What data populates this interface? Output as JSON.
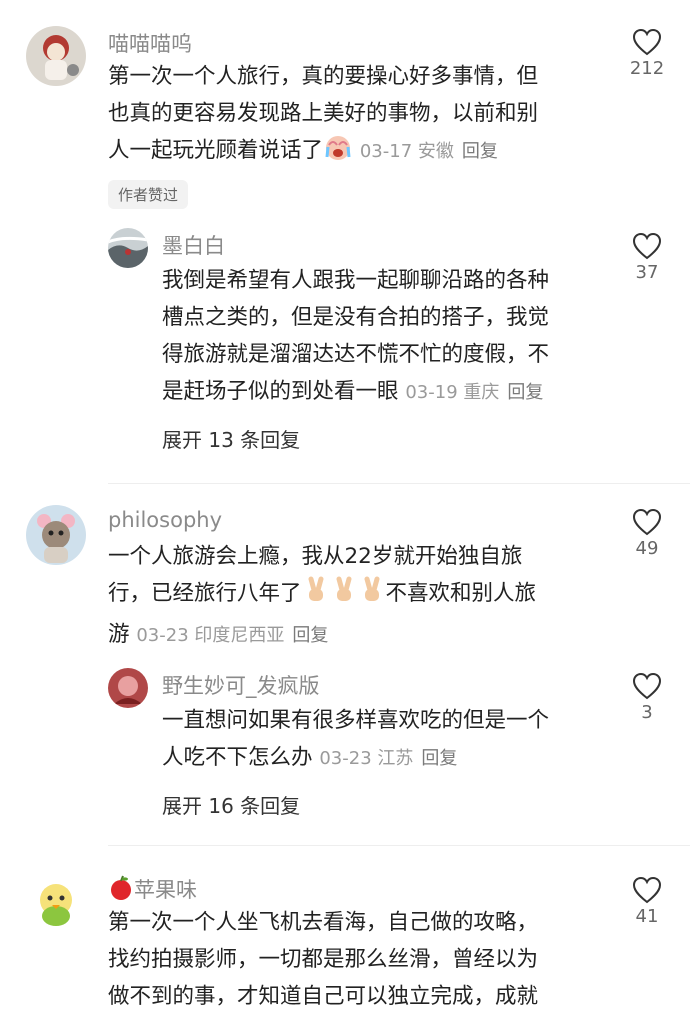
{
  "comments": [
    {
      "username": "喵喵喵呜",
      "lines": [
        "第一次一个人旅行，真的要操心好多事情，但",
        "也真的更容易发现路上美好的事物，以前和别",
        "人一起玩光顾着说话了"
      ],
      "date": "03-17",
      "location": "安徽",
      "reply": "回复",
      "likes": "212",
      "tag": "作者赞过",
      "emoji": "crying-face",
      "replies": [
        {
          "username": "墨白白",
          "lines": [
            "我倒是希望有人跟我一起聊聊沿路的各种",
            "槽点之类的，但是没有合拍的搭子，我觉",
            "得旅游就是溜溜达达不慌不忙的度假，不",
            "是赶场子似的到处看一眼"
          ],
          "date": "03-19",
          "location": "重庆",
          "reply": "回复",
          "likes": "37"
        }
      ],
      "expand": "展开 13 条回复"
    },
    {
      "username": "philosophy",
      "lines": [
        "一个人旅游会上瘾，我从22岁就开始独自旅",
        "行，已经旅行八年了",
        "游"
      ],
      "line2_tail": "不喜欢和别人旅",
      "date": "03-23",
      "location": "印度尼西亚",
      "reply": "回复",
      "likes": "49",
      "emoji": "victory-hand",
      "replies": [
        {
          "username": "野生妙可_发疯版",
          "lines": [
            "一直想问如果有很多样喜欢吃的但是一个",
            "人吃不下怎么办"
          ],
          "date": "03-23",
          "location": "江苏",
          "reply": "回复",
          "likes": "3"
        }
      ],
      "expand": "展开 16 条回复"
    },
    {
      "username": "苹果味",
      "username_emoji": "red-apple",
      "lines": [
        "第一次一个人坐飞机去看海，自己做的攻略，",
        "找约拍摄影师，一切都是那么丝滑，曾经以为",
        "做不到的事，才知道自己可以独立完成，成就"
      ],
      "likes": "41"
    }
  ],
  "colors": {
    "heart": "#333333",
    "meta": "#9a9a9a",
    "username": "#8a8a8a"
  }
}
